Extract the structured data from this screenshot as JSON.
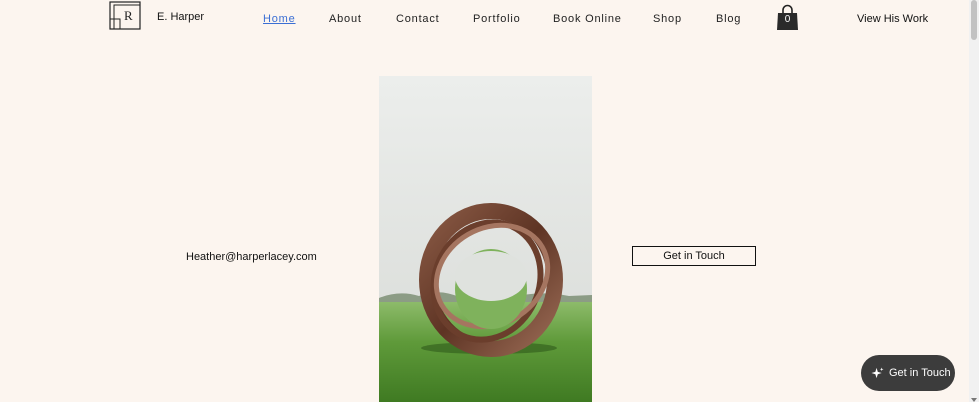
{
  "header": {
    "brand": "E. Harper",
    "logo_letter": "R",
    "nav": [
      {
        "label": "Home",
        "active": true
      },
      {
        "label": "About"
      },
      {
        "label": "Contact"
      },
      {
        "label": "Portfolio"
      },
      {
        "label": "Book Online"
      },
      {
        "label": "Shop"
      },
      {
        "label": "Blog"
      }
    ],
    "cart_count": "0",
    "view_work": "View His Work"
  },
  "main": {
    "email": "Heather@harperlacey.com",
    "cta_label": "Get in Touch"
  },
  "chat": {
    "label": "Get in Touch",
    "icon": "sparkle-icon"
  },
  "colors": {
    "background": "#fcf5ef",
    "active_link": "#3b6fd4",
    "chat_bg": "#3c3c3c"
  }
}
